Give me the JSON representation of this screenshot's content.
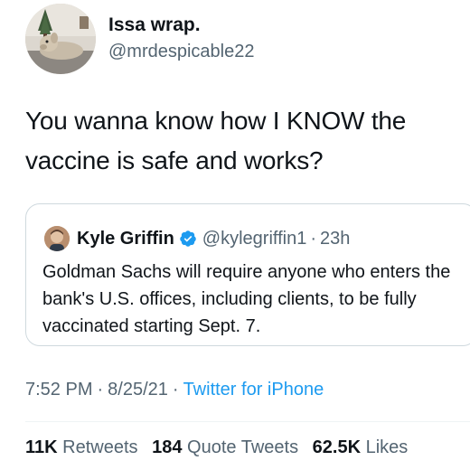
{
  "tweet": {
    "author": {
      "display_name": "Issa wrap.",
      "handle": "@mrdespicable22"
    },
    "text": "You wanna know how I KNOW the vaccine is safe and works?",
    "quoted_tweet": {
      "author_name": "Kyle Griffin",
      "verified_icon": "verified-badge-icon",
      "handle": "@kylegriffin1",
      "separator": "·",
      "time": "23h",
      "text": "Goldman Sachs will require anyone who enters the bank's U.S. offices, including clients, to be fully vaccinated starting Sept. 7."
    },
    "meta": {
      "time": "7:52 PM",
      "separator": "·",
      "date": "8/25/21",
      "source": "Twitter for iPhone"
    },
    "stats": {
      "retweets_count": "11K",
      "retweets_label": "Retweets",
      "quote_tweets_count": "184",
      "quote_tweets_label": "Quote Tweets",
      "likes_count": "62.5K",
      "likes_label": "Likes"
    }
  },
  "colors": {
    "text": "#0f1419",
    "secondary": "#536471",
    "link": "#1d9bf0",
    "border": "#cfd9de"
  }
}
